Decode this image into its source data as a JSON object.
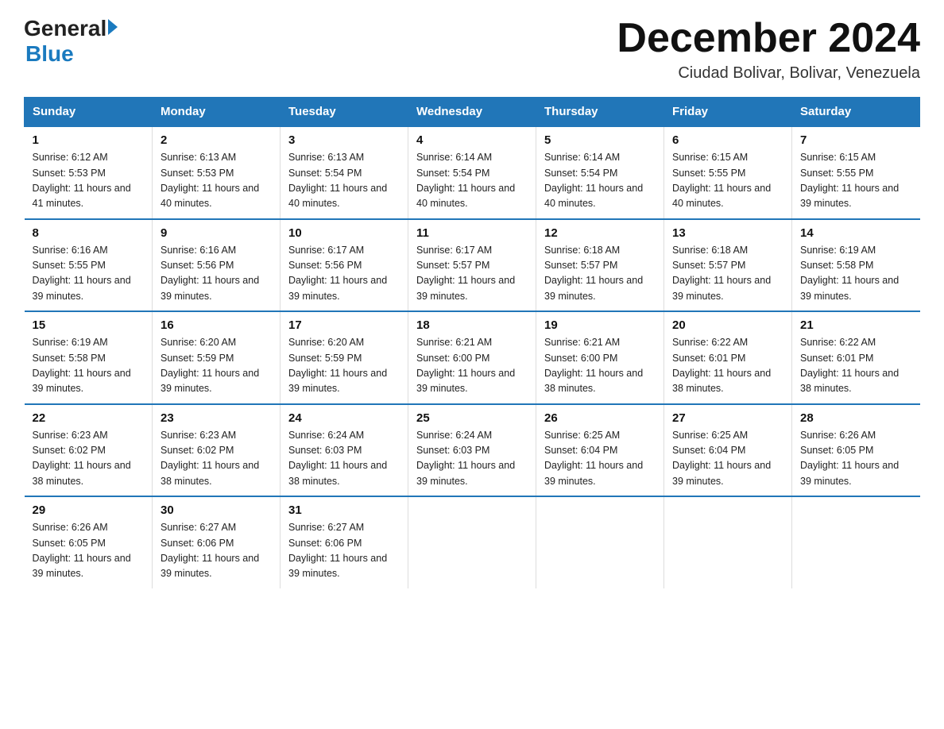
{
  "logo": {
    "general": "General",
    "blue": "Blue"
  },
  "title": "December 2024",
  "subtitle": "Ciudad Bolivar, Bolivar, Venezuela",
  "days_of_week": [
    "Sunday",
    "Monday",
    "Tuesday",
    "Wednesday",
    "Thursday",
    "Friday",
    "Saturday"
  ],
  "weeks": [
    [
      {
        "day": 1,
        "sunrise": "6:12 AM",
        "sunset": "5:53 PM",
        "daylight": "11 hours and 41 minutes."
      },
      {
        "day": 2,
        "sunrise": "6:13 AM",
        "sunset": "5:53 PM",
        "daylight": "11 hours and 40 minutes."
      },
      {
        "day": 3,
        "sunrise": "6:13 AM",
        "sunset": "5:54 PM",
        "daylight": "11 hours and 40 minutes."
      },
      {
        "day": 4,
        "sunrise": "6:14 AM",
        "sunset": "5:54 PM",
        "daylight": "11 hours and 40 minutes."
      },
      {
        "day": 5,
        "sunrise": "6:14 AM",
        "sunset": "5:54 PM",
        "daylight": "11 hours and 40 minutes."
      },
      {
        "day": 6,
        "sunrise": "6:15 AM",
        "sunset": "5:55 PM",
        "daylight": "11 hours and 40 minutes."
      },
      {
        "day": 7,
        "sunrise": "6:15 AM",
        "sunset": "5:55 PM",
        "daylight": "11 hours and 39 minutes."
      }
    ],
    [
      {
        "day": 8,
        "sunrise": "6:16 AM",
        "sunset": "5:55 PM",
        "daylight": "11 hours and 39 minutes."
      },
      {
        "day": 9,
        "sunrise": "6:16 AM",
        "sunset": "5:56 PM",
        "daylight": "11 hours and 39 minutes."
      },
      {
        "day": 10,
        "sunrise": "6:17 AM",
        "sunset": "5:56 PM",
        "daylight": "11 hours and 39 minutes."
      },
      {
        "day": 11,
        "sunrise": "6:17 AM",
        "sunset": "5:57 PM",
        "daylight": "11 hours and 39 minutes."
      },
      {
        "day": 12,
        "sunrise": "6:18 AM",
        "sunset": "5:57 PM",
        "daylight": "11 hours and 39 minutes."
      },
      {
        "day": 13,
        "sunrise": "6:18 AM",
        "sunset": "5:57 PM",
        "daylight": "11 hours and 39 minutes."
      },
      {
        "day": 14,
        "sunrise": "6:19 AM",
        "sunset": "5:58 PM",
        "daylight": "11 hours and 39 minutes."
      }
    ],
    [
      {
        "day": 15,
        "sunrise": "6:19 AM",
        "sunset": "5:58 PM",
        "daylight": "11 hours and 39 minutes."
      },
      {
        "day": 16,
        "sunrise": "6:20 AM",
        "sunset": "5:59 PM",
        "daylight": "11 hours and 39 minutes."
      },
      {
        "day": 17,
        "sunrise": "6:20 AM",
        "sunset": "5:59 PM",
        "daylight": "11 hours and 39 minutes."
      },
      {
        "day": 18,
        "sunrise": "6:21 AM",
        "sunset": "6:00 PM",
        "daylight": "11 hours and 39 minutes."
      },
      {
        "day": 19,
        "sunrise": "6:21 AM",
        "sunset": "6:00 PM",
        "daylight": "11 hours and 38 minutes."
      },
      {
        "day": 20,
        "sunrise": "6:22 AM",
        "sunset": "6:01 PM",
        "daylight": "11 hours and 38 minutes."
      },
      {
        "day": 21,
        "sunrise": "6:22 AM",
        "sunset": "6:01 PM",
        "daylight": "11 hours and 38 minutes."
      }
    ],
    [
      {
        "day": 22,
        "sunrise": "6:23 AM",
        "sunset": "6:02 PM",
        "daylight": "11 hours and 38 minutes."
      },
      {
        "day": 23,
        "sunrise": "6:23 AM",
        "sunset": "6:02 PM",
        "daylight": "11 hours and 38 minutes."
      },
      {
        "day": 24,
        "sunrise": "6:24 AM",
        "sunset": "6:03 PM",
        "daylight": "11 hours and 38 minutes."
      },
      {
        "day": 25,
        "sunrise": "6:24 AM",
        "sunset": "6:03 PM",
        "daylight": "11 hours and 39 minutes."
      },
      {
        "day": 26,
        "sunrise": "6:25 AM",
        "sunset": "6:04 PM",
        "daylight": "11 hours and 39 minutes."
      },
      {
        "day": 27,
        "sunrise": "6:25 AM",
        "sunset": "6:04 PM",
        "daylight": "11 hours and 39 minutes."
      },
      {
        "day": 28,
        "sunrise": "6:26 AM",
        "sunset": "6:05 PM",
        "daylight": "11 hours and 39 minutes."
      }
    ],
    [
      {
        "day": 29,
        "sunrise": "6:26 AM",
        "sunset": "6:05 PM",
        "daylight": "11 hours and 39 minutes."
      },
      {
        "day": 30,
        "sunrise": "6:27 AM",
        "sunset": "6:06 PM",
        "daylight": "11 hours and 39 minutes."
      },
      {
        "day": 31,
        "sunrise": "6:27 AM",
        "sunset": "6:06 PM",
        "daylight": "11 hours and 39 minutes."
      },
      null,
      null,
      null,
      null
    ]
  ]
}
